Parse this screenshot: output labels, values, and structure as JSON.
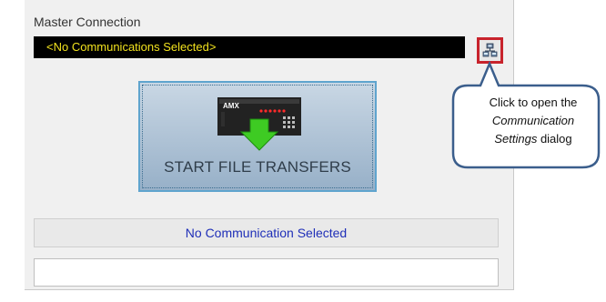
{
  "master_connection": {
    "label": "Master Connection",
    "value": "<No Communications Selected>"
  },
  "settings_button": {
    "icon": "network-settings-icon"
  },
  "transfer_button": {
    "label": "START FILE TRANSFERS",
    "device_brand": "AMX"
  },
  "status": {
    "text": "No Communication Selected"
  },
  "file_input": {
    "value": ""
  },
  "callout": {
    "line1": "Click to open the",
    "line2": "Communication",
    "line3_em": "Settings",
    "line3_rest": " dialog"
  },
  "colors": {
    "connection_text": "#f2e21e",
    "status_text": "#1f2fb8",
    "highlight_border": "#c8232c",
    "callout_border": "#3b5e8c"
  }
}
